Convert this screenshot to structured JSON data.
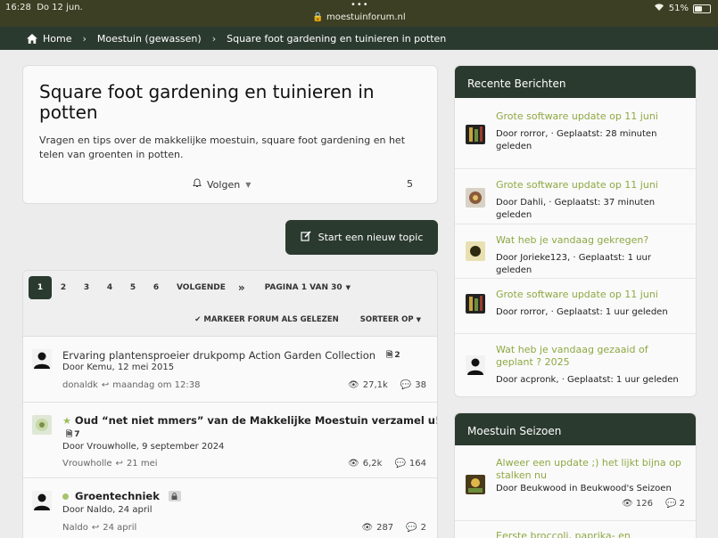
{
  "status": {
    "time": "16:28",
    "date": "Do 12 jun.",
    "dots": "•••",
    "url": "moestuinforum.nl",
    "battery": "51%",
    "battery_level": 0.51
  },
  "breadcrumb": {
    "home": "Home",
    "section": "Moestuin (gewassen)",
    "current": "Square foot gardening en tuinieren in potten"
  },
  "forum": {
    "title": "Square foot gardening en tuinieren in potten",
    "description": "Vragen en tips over de makkelijke moestuin, square foot gardening en het telen van groenten in potten.",
    "follow_label": "Volgen",
    "follow_count": "5"
  },
  "new_topic_label": "Start een nieuw topic",
  "pager": {
    "pages": [
      "1",
      "2",
      "3",
      "4",
      "5",
      "6"
    ],
    "next": "VOLGENDE",
    "last": "»",
    "page_of": "PAGINA 1 VAN 30",
    "mark_read": "MARKEER FORUM ALS GELEZEN",
    "sort": "SORTEER OP"
  },
  "topics": [
    {
      "title": "Ervaring plantensproeier drukpomp Action Garden Collection",
      "pages": "2",
      "starter": "Door Kemu, 12 mei 2015",
      "last_user": "donaldk",
      "last_date": "maandag om 12:38",
      "views": "27,1k",
      "replies": "38"
    },
    {
      "title": "Oud “net niet mmers” van de Makkelijke Moestuin verzamel u!!",
      "emoji": "😊",
      "pages": "7",
      "starter": "Door Vrouwholle, 9 september 2024",
      "last_user": "Vrouwholle",
      "last_date": "21 mei",
      "views": "6,2k",
      "replies": "164"
    },
    {
      "title": "Groentechniek",
      "starter": "Door Naldo, 24 april",
      "last_user": "Naldo",
      "last_date": "24 april",
      "views": "287",
      "replies": "2"
    }
  ],
  "recent": {
    "heading": "Recente Berichten",
    "items": [
      {
        "link": "Grote software update op 11 juni",
        "meta": "Door rorror, · Geplaatst: 28 minuten geleden"
      },
      {
        "link": "Grote software update op 11 juni",
        "meta": "Door Dahli, · Geplaatst: 37 minuten geleden"
      },
      {
        "link": "Wat heb je vandaag gekregen?",
        "meta": "Door Jorieke123, · Geplaatst: 1 uur geleden"
      },
      {
        "link": "Grote software update op 11 juni",
        "meta": "Door rorror, · Geplaatst: 1 uur geleden"
      },
      {
        "link": "Wat heb je vandaag gezaaid of geplant ? 2025",
        "meta": "Door acpronk, · Geplaatst: 1 uur geleden"
      }
    ]
  },
  "season": {
    "heading": "Moestuin Seizoen",
    "items": [
      {
        "link": "Alweer een update ;) het lijkt bijna op stalken nu",
        "meta": "Door Beukwood in Beukwood's Seizoen",
        "views": "126",
        "replies": "2"
      },
      {
        "link": "Eerste broccoli, paprika- en babywortels"
      }
    ]
  },
  "colors": {
    "accent": "#2b3a2f",
    "link": "#8ea843",
    "topbar": "#3c3f24"
  }
}
